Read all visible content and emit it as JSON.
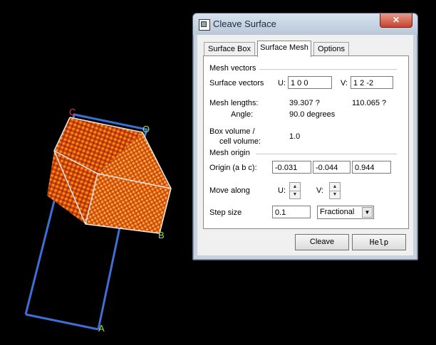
{
  "viewport": {
    "axis_labels": {
      "o": "O",
      "a": "A",
      "b": "B",
      "c": "C"
    },
    "colors": {
      "cell_frame": "#3e6fd6",
      "cleave_box": "#e6e6e6",
      "crystal": "#f06a10"
    }
  },
  "dialog": {
    "title": "Cleave Surface",
    "close_label": "✕",
    "tabs": [
      "Surface Box",
      "Surface Mesh",
      "Options"
    ],
    "active_tab": "Surface Mesh",
    "mesh_vectors": {
      "section_label": "Mesh vectors",
      "row_label": "Surface vectors",
      "u_label": "U:",
      "u_value": "1  0  0",
      "v_label": "V:",
      "v_value": "1  2  -2",
      "lengths_label": "Mesh lengths:",
      "length_u": "39.307 ?",
      "length_v": "110.065 ?",
      "angle_label": "Angle:",
      "angle_value": "90.0 degrees",
      "volume_label_line1": "Box volume /",
      "volume_label_line2": "cell volume:",
      "volume_value": "1.0"
    },
    "mesh_origin": {
      "section_label": "Mesh origin",
      "origin_label": "Origin (a b c):",
      "origin_a": "-0.031",
      "origin_b": "-0.044",
      "origin_c": "0.944",
      "move_label": "Move along",
      "move_u_label": "U:",
      "move_v_label": "V:",
      "step_label": "Step size",
      "step_value": "0.1",
      "step_unit": "Fractional"
    },
    "buttons": {
      "cleave": "Cleave",
      "help": "Help"
    }
  }
}
